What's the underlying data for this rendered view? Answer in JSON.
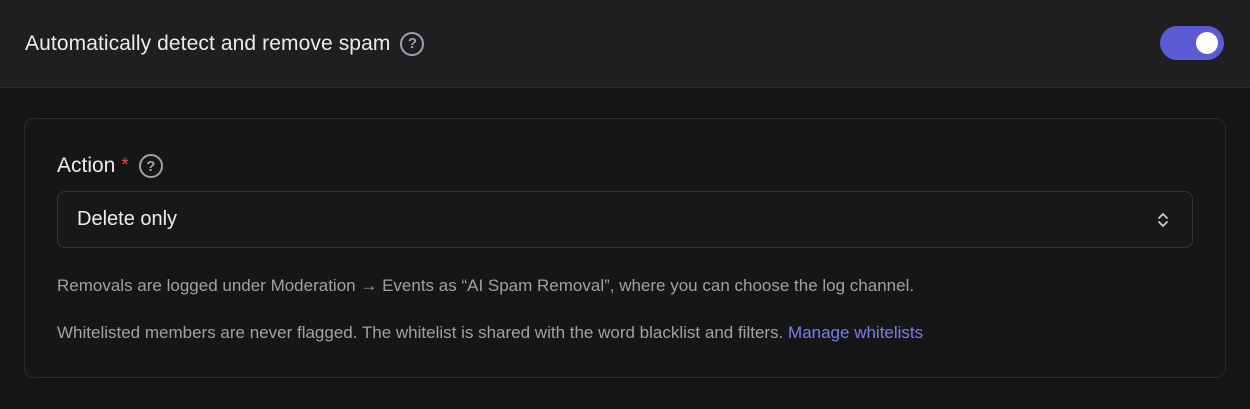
{
  "header": {
    "title": "Automatically detect and remove spam",
    "help_glyph": "?",
    "toggle_on": true,
    "accent_color": "#5b5bd6"
  },
  "action": {
    "label": "Action",
    "required_mark": "*",
    "help_glyph": "?",
    "selected_value": "Delete only",
    "chevron_icon": "chevron-up-down-icon"
  },
  "hints": {
    "logging": "Removals are logged under Moderation → Events as “AI Spam Removal”, where you can choose the log channel.",
    "whitelist_text": "Whitelisted members are never flagged. The whitelist is shared with the word blacklist and filters.",
    "whitelist_link": "Manage whitelists"
  }
}
